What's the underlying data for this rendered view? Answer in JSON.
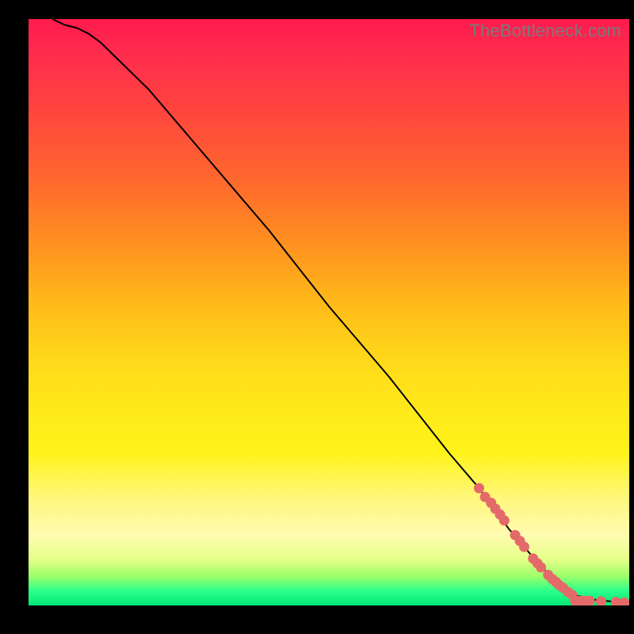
{
  "watermark": "TheBottleneck.com",
  "chart_data": {
    "type": "line",
    "title": "",
    "xlabel": "",
    "ylabel": "",
    "xlim": [
      0,
      100
    ],
    "ylim": [
      0,
      100
    ],
    "series": [
      {
        "name": "curve",
        "x": [
          4,
          6,
          8,
          10,
          12,
          14,
          20,
          30,
          40,
          50,
          60,
          70,
          75,
          80,
          85,
          88,
          90,
          92,
          94,
          96,
          98,
          100
        ],
        "y": [
          100,
          99,
          98.5,
          97.5,
          96,
          94,
          88,
          76,
          64,
          51,
          39,
          26,
          20,
          13,
          7,
          4,
          2,
          1.5,
          1.0,
          0.8,
          0.6,
          0.5
        ]
      }
    ],
    "points": [
      {
        "x": 75,
        "y": 20
      },
      {
        "x": 76,
        "y": 18.5
      },
      {
        "x": 77,
        "y": 17.5
      },
      {
        "x": 77.7,
        "y": 16.5
      },
      {
        "x": 78.5,
        "y": 15.5
      },
      {
        "x": 79.2,
        "y": 14.5
      },
      {
        "x": 81,
        "y": 12
      },
      {
        "x": 81.8,
        "y": 11
      },
      {
        "x": 82.5,
        "y": 10
      },
      {
        "x": 84,
        "y": 8
      },
      {
        "x": 84.7,
        "y": 7.2
      },
      {
        "x": 85.3,
        "y": 6.5
      },
      {
        "x": 86.5,
        "y": 5.2
      },
      {
        "x": 87.2,
        "y": 4.5
      },
      {
        "x": 87.8,
        "y": 4.0
      },
      {
        "x": 88.3,
        "y": 3.5
      },
      {
        "x": 89,
        "y": 3.0
      },
      {
        "x": 89.8,
        "y": 2.3
      },
      {
        "x": 90.5,
        "y": 1.8
      },
      {
        "x": 91,
        "y": 0.8
      },
      {
        "x": 91.6,
        "y": 0.8
      },
      {
        "x": 92.2,
        "y": 0.8
      },
      {
        "x": 92.8,
        "y": 0.8
      },
      {
        "x": 93.4,
        "y": 0.8
      },
      {
        "x": 95.3,
        "y": 0.7
      },
      {
        "x": 97.8,
        "y": 0.6
      },
      {
        "x": 99.2,
        "y": 0.5
      }
    ],
    "gradient_stops": [
      {
        "pos": 0,
        "color": "#ff1a4d"
      },
      {
        "pos": 18,
        "color": "#ff5a30"
      },
      {
        "pos": 40,
        "color": "#ffa51a"
      },
      {
        "pos": 62,
        "color": "#ffe81a"
      },
      {
        "pos": 82,
        "color": "#fff780"
      },
      {
        "pos": 93,
        "color": "#d9ff6a"
      },
      {
        "pos": 100,
        "color": "#00e676"
      }
    ]
  }
}
